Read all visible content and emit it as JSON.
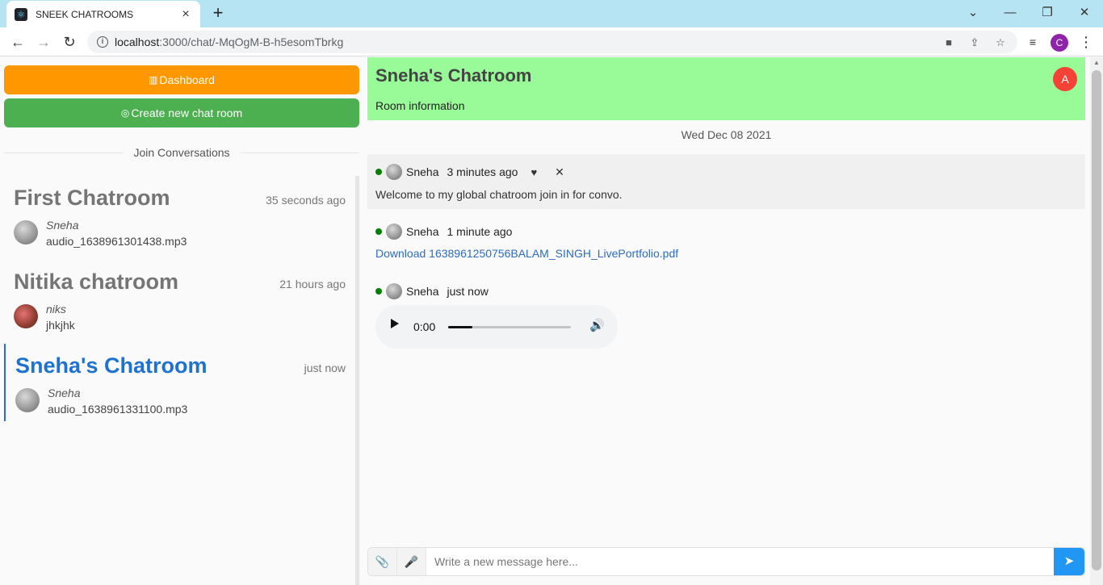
{
  "browser": {
    "tab_title": "SNEEK CHATROOMS",
    "url_host": "localhost",
    "url_path": ":3000/chat/-MqOgM-B-h5esomTbrkg",
    "profile_letter": "C"
  },
  "sidebar": {
    "dashboard_label": "Dashboard",
    "create_label": "Create new chat room",
    "divider_label": "Join Conversations",
    "rooms": [
      {
        "title": "First Chatroom",
        "time": "35 seconds ago",
        "author": "Sneha",
        "last_message": "audio_1638961301438.mp3"
      },
      {
        "title": "Nitika chatroom",
        "time": "21 hours ago",
        "author": "niks",
        "last_message": "jhkjhk"
      },
      {
        "title": "Sneha's Chatroom",
        "time": "just now",
        "author": "Sneha",
        "last_message": "audio_1638961331100.mp3"
      }
    ]
  },
  "chat": {
    "title": "Sneha's Chatroom",
    "info_label": "Room information",
    "avatar_letter": "A",
    "date": "Wed Dec 08 2021",
    "messages": [
      {
        "author": "Sneha",
        "time": "3 minutes ago",
        "text": "Welcome to my global chatroom join in for convo."
      },
      {
        "author": "Sneha",
        "time": "1 minute ago",
        "link": "Download 1638961250756BALAM_SINGH_LivePortfolio.pdf"
      },
      {
        "author": "Sneha",
        "time": "just now",
        "audio_time": "0:00",
        "audio_progress": 0.2
      }
    ],
    "composer_placeholder": "Write a new message here..."
  },
  "colors": {
    "dashboard": "#ff9800",
    "create": "#4caf50",
    "header_bg": "#98fb98",
    "active_room": "#1e73d0",
    "send": "#2196f3"
  }
}
